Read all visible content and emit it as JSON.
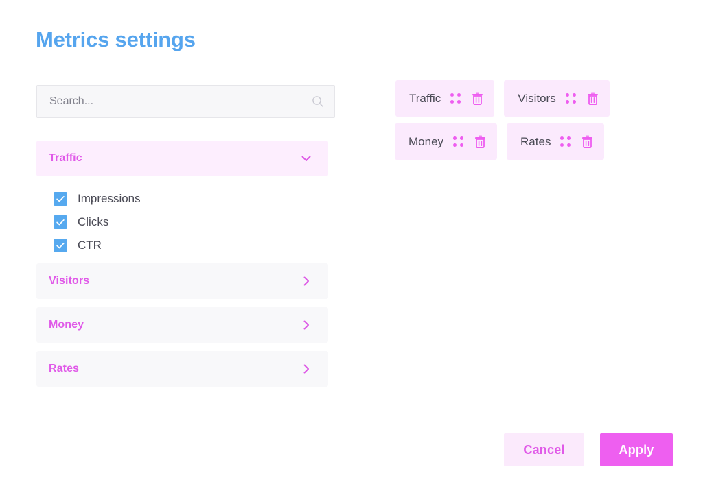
{
  "page": {
    "title": "Metrics settings"
  },
  "colors": {
    "title_blue": "#56a5ee",
    "accent_magenta": "#e05ae8",
    "apply_bg": "#ee5ff0",
    "chip_bg": "#fbeafd",
    "open_header_bg": "#fdeefe",
    "closed_header_bg": "#f8f8fa",
    "checkbox_blue": "#56a9ef",
    "search_bg": "#f7f7f9"
  },
  "search": {
    "placeholder": "Search...",
    "value": "",
    "icon": "search-icon"
  },
  "accordion": {
    "sections": [
      {
        "label": "Traffic",
        "expanded": true,
        "icon": "chevron-down-icon",
        "options": [
          {
            "label": "Impressions",
            "checked": true
          },
          {
            "label": "Clicks",
            "checked": true
          },
          {
            "label": "CTR",
            "checked": true
          }
        ]
      },
      {
        "label": "Visitors",
        "expanded": false,
        "icon": "chevron-right-icon",
        "options": []
      },
      {
        "label": "Money",
        "expanded": false,
        "icon": "chevron-right-icon",
        "options": []
      },
      {
        "label": "Rates",
        "expanded": false,
        "icon": "chevron-right-icon",
        "options": []
      }
    ]
  },
  "chips": {
    "rows": [
      [
        {
          "label": "Traffic",
          "drag_icon": "drag-handle-icon",
          "delete_icon": "trash-icon"
        },
        {
          "label": "Visitors",
          "drag_icon": "drag-handle-icon",
          "delete_icon": "trash-icon"
        }
      ],
      [
        {
          "label": "Money",
          "drag_icon": "drag-handle-icon",
          "delete_icon": "trash-icon"
        },
        {
          "label": "Rates",
          "drag_icon": "drag-handle-icon",
          "delete_icon": "trash-icon"
        }
      ]
    ]
  },
  "footer": {
    "cancel_label": "Cancel",
    "apply_label": "Apply"
  }
}
